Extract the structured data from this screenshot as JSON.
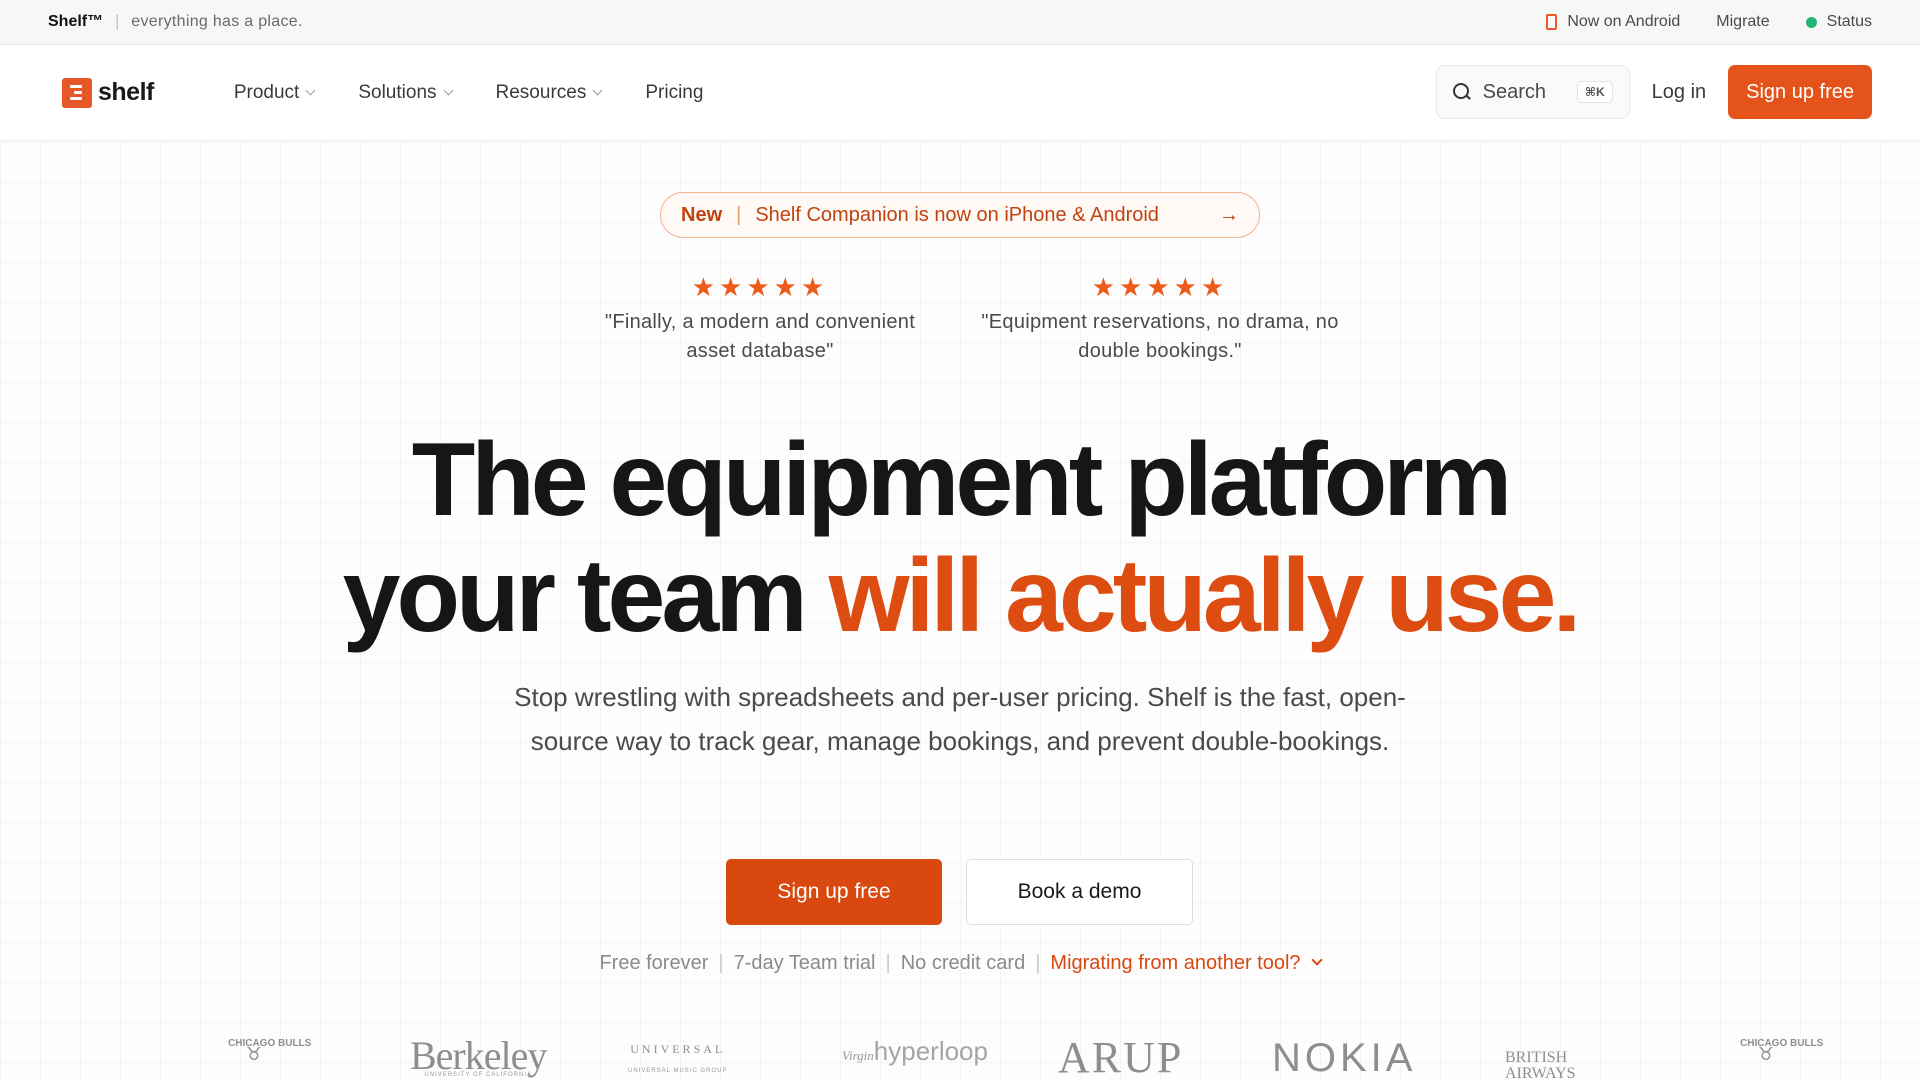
{
  "topbar": {
    "brand": "Shelf™",
    "separator": "|",
    "tagline": "everything has a place.",
    "android": "Now on Android",
    "migrate": "Migrate",
    "status": "Status"
  },
  "nav": {
    "logo_text": "shelf",
    "links": [
      "Product",
      "Solutions",
      "Resources",
      "Pricing"
    ],
    "search_label": "Search",
    "search_shortcut": "⌘K",
    "login": "Log in",
    "signup": "Sign up free"
  },
  "announcement": {
    "badge": "New",
    "separator": "|",
    "text": "Shelf Companion is now on iPhone & Android",
    "arrow": "→"
  },
  "reviews": [
    {
      "stars": "★★★★★",
      "rating": 5,
      "quote": "\"Finally, a modern and convenient asset database\""
    },
    {
      "stars": "★★★★★",
      "rating": 5,
      "quote": "\"Equipment reservations, no drama, no double bookings.\""
    }
  ],
  "hero": {
    "headline_line1": "The equipment platform",
    "headline_line2_plain": "your team ",
    "headline_line2_accent": "will actually use.",
    "subhead": "Stop wrestling with spreadsheets and per-user pricing. Shelf is the fast, open-source way to track gear, manage bookings, and prevent double-bookings.",
    "cta_primary": "Sign up free",
    "cta_secondary": "Book a demo"
  },
  "footnote": {
    "items": [
      "Free forever",
      "7-day Team trial",
      "No credit card"
    ],
    "separator": "|",
    "migrate_link": "Migrating from another tool?"
  },
  "logos": {
    "bulls_1": "CHICAGO BULLS",
    "berkeley": "Berkeley",
    "berkeley_sub": "UNIVERSITY OF CALIFORNIA",
    "universal": "UNIVERSAL",
    "universal_sub": "UNIVERSAL MUSIC GROUP",
    "virgin": "Virgin",
    "hyperloop": "hyperloop",
    "arup": "ARUP",
    "nokia": "NOKIA",
    "ba": "BRITISH AIRWAYS",
    "bulls_2": "CHICAGO BULLS"
  },
  "colors": {
    "accent": "#dd4d12",
    "button": "#e3531a",
    "status": "#22b573"
  }
}
